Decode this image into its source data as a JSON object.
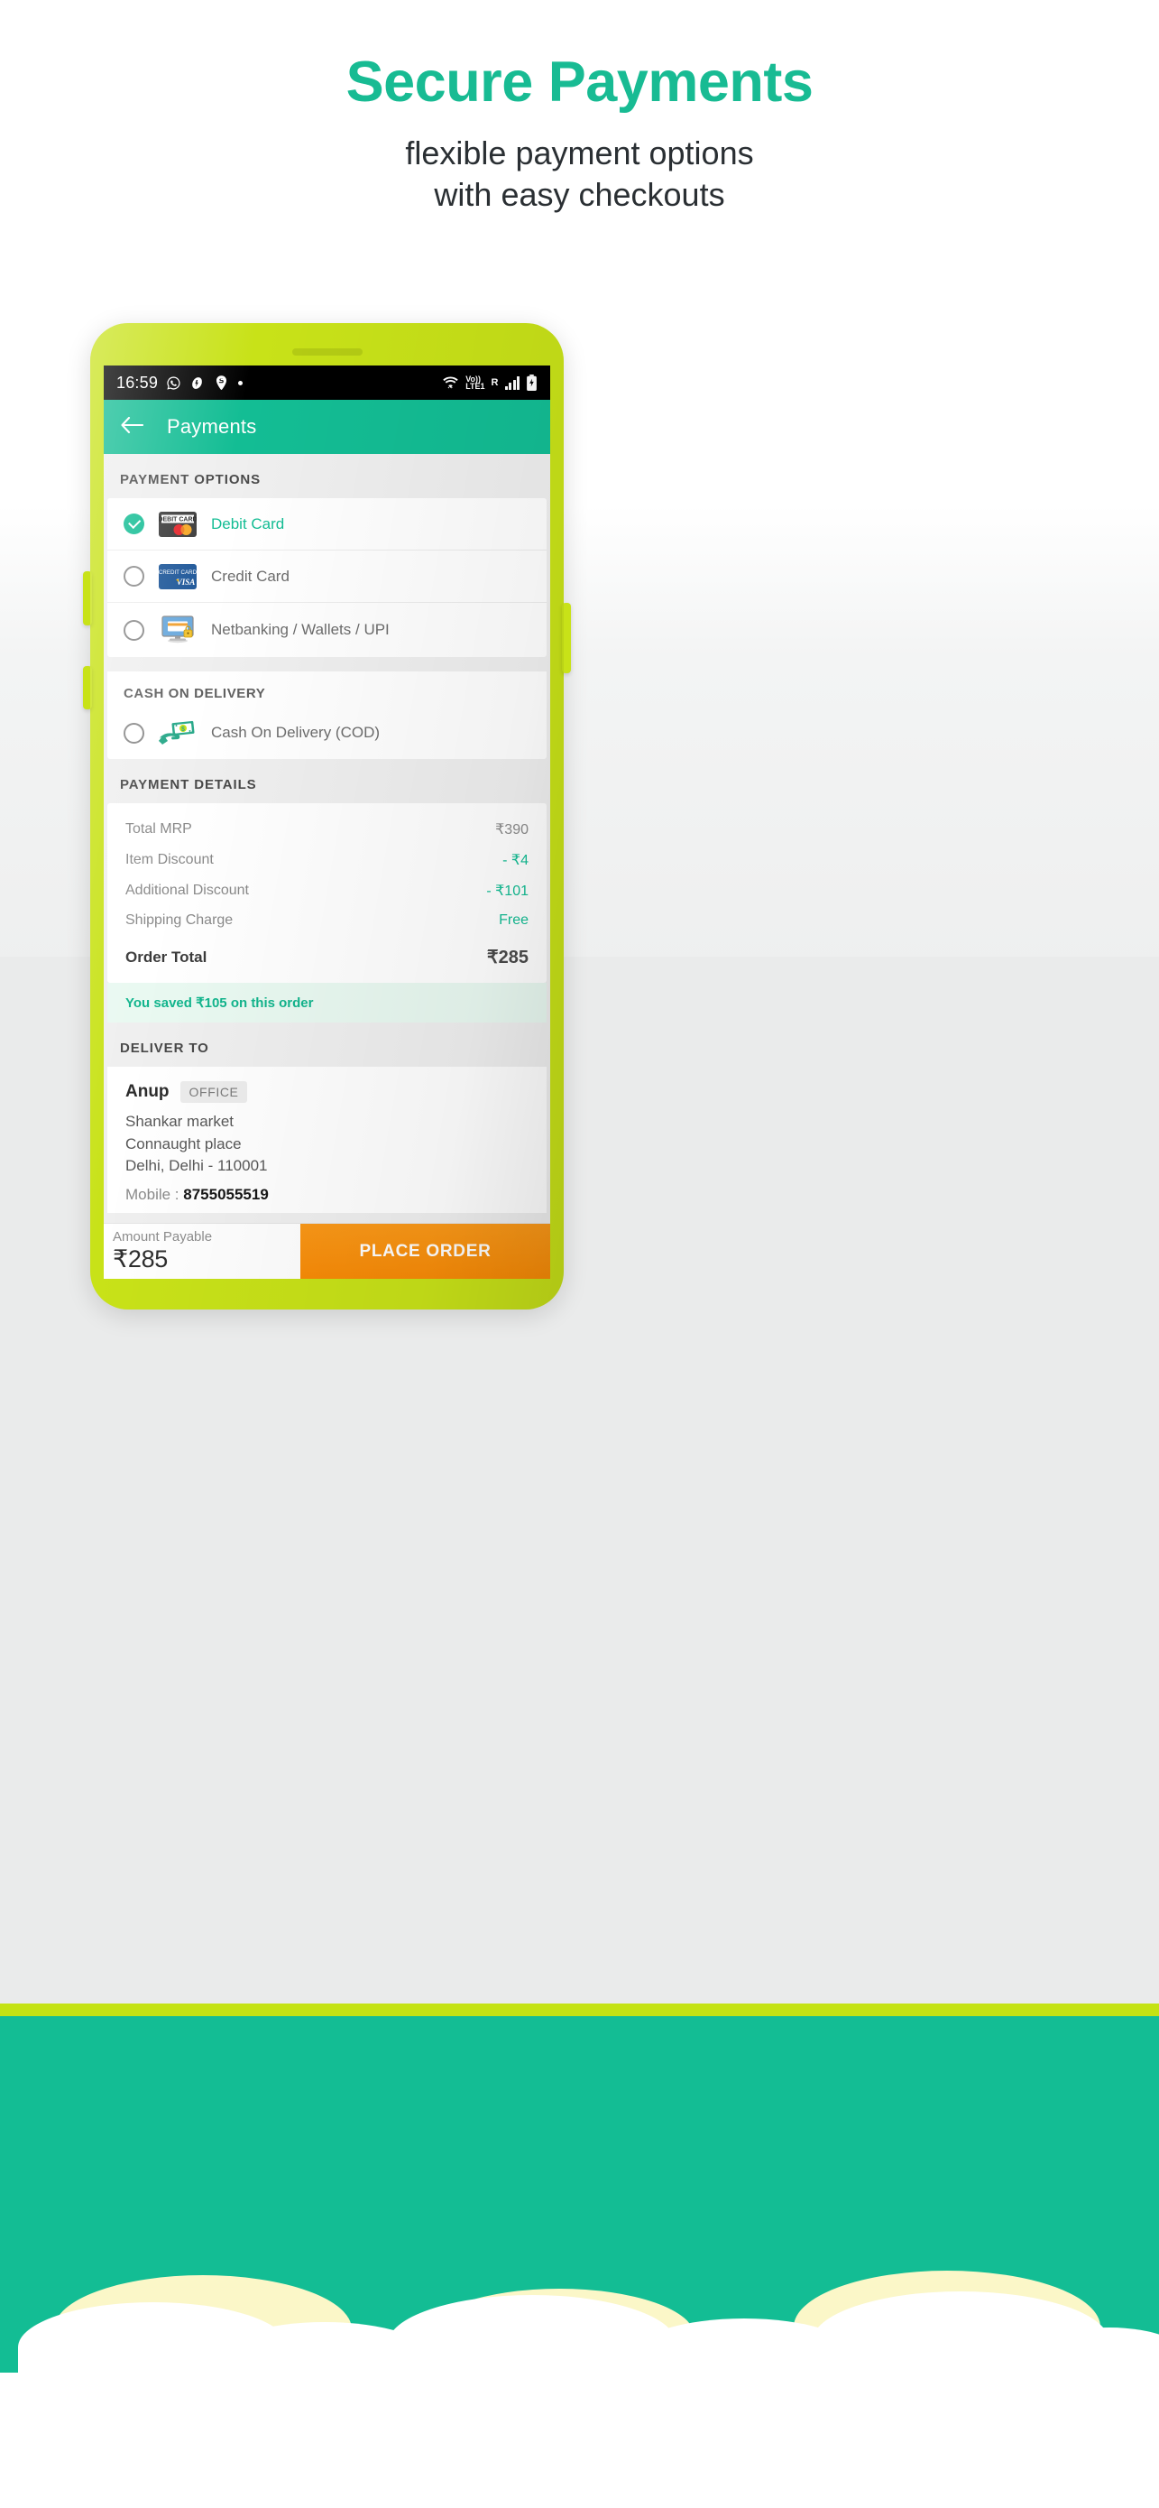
{
  "promo": {
    "headline": "Secure Payments",
    "subhead_line1": "flexible payment options",
    "subhead_line2": "with easy checkouts",
    "headline_color": "#18bb93"
  },
  "phone": {
    "statusbar": {
      "time": "16:59",
      "left_icons": [
        "whatsapp-icon",
        "app-icon",
        "swiggy-icon",
        "dot-icon"
      ],
      "right_icons": [
        "wifi-icon",
        "volte-icon",
        "roaming-icon",
        "signal-icon",
        "battery-charging-icon"
      ],
      "volte_top": "Vo))",
      "volte_bottom": "LTE1",
      "roaming": "R"
    },
    "appbar": {
      "back_icon": "back-arrow-icon",
      "title": "Payments"
    },
    "payment_options": {
      "section_title": "PAYMENT OPTIONS",
      "options": [
        {
          "label": "Debit Card",
          "selected": true,
          "icon": "mastercard-debit-card-icon",
          "card_text": "DEBIT CARD"
        },
        {
          "label": "Credit Card",
          "selected": false,
          "icon": "visa-credit-card-icon",
          "card_text": "CREDIT CARD"
        },
        {
          "label": "Netbanking / Wallets / UPI",
          "selected": false,
          "icon": "netbanking-monitor-lock-icon",
          "card_text": ""
        }
      ]
    },
    "cash_on_delivery": {
      "section_title": "CASH ON DELIVERY",
      "options": [
        {
          "label": "Cash On Delivery (COD)",
          "selected": false,
          "icon": "cash-hand-icon"
        }
      ]
    },
    "payment_details": {
      "section_title": "PAYMENT DETAILS",
      "rows": [
        {
          "label": "Total MRP",
          "value": "₹390",
          "green": false
        },
        {
          "label": "Item Discount",
          "value": "- ₹4",
          "green": true
        },
        {
          "label": "Additional Discount",
          "value": "- ₹101",
          "green": true
        },
        {
          "label": "Shipping Charge",
          "value": "Free",
          "green": true
        }
      ],
      "total": {
        "label": "Order Total",
        "value": "₹285"
      },
      "saved_banner": "You saved ₹105 on this order"
    },
    "deliver_to": {
      "section_title": "DELIVER TO",
      "name": "Anup",
      "tag": "OFFICE",
      "address_lines": [
        "Shankar market",
        "Connaught place",
        "Delhi, Delhi - 110001"
      ],
      "mobile_label": "Mobile : ",
      "mobile_number": "8755055519"
    },
    "bottom_bar": {
      "amount_label": "Amount Payable",
      "amount_value": "₹285",
      "place_order_label": "PLACE ORDER",
      "place_order_color": "#f78a06"
    }
  },
  "colors": {
    "teal": "#13bd94",
    "lime": "#c8e218",
    "orange": "#f78a06",
    "grey_bg": "#eaebeb"
  }
}
